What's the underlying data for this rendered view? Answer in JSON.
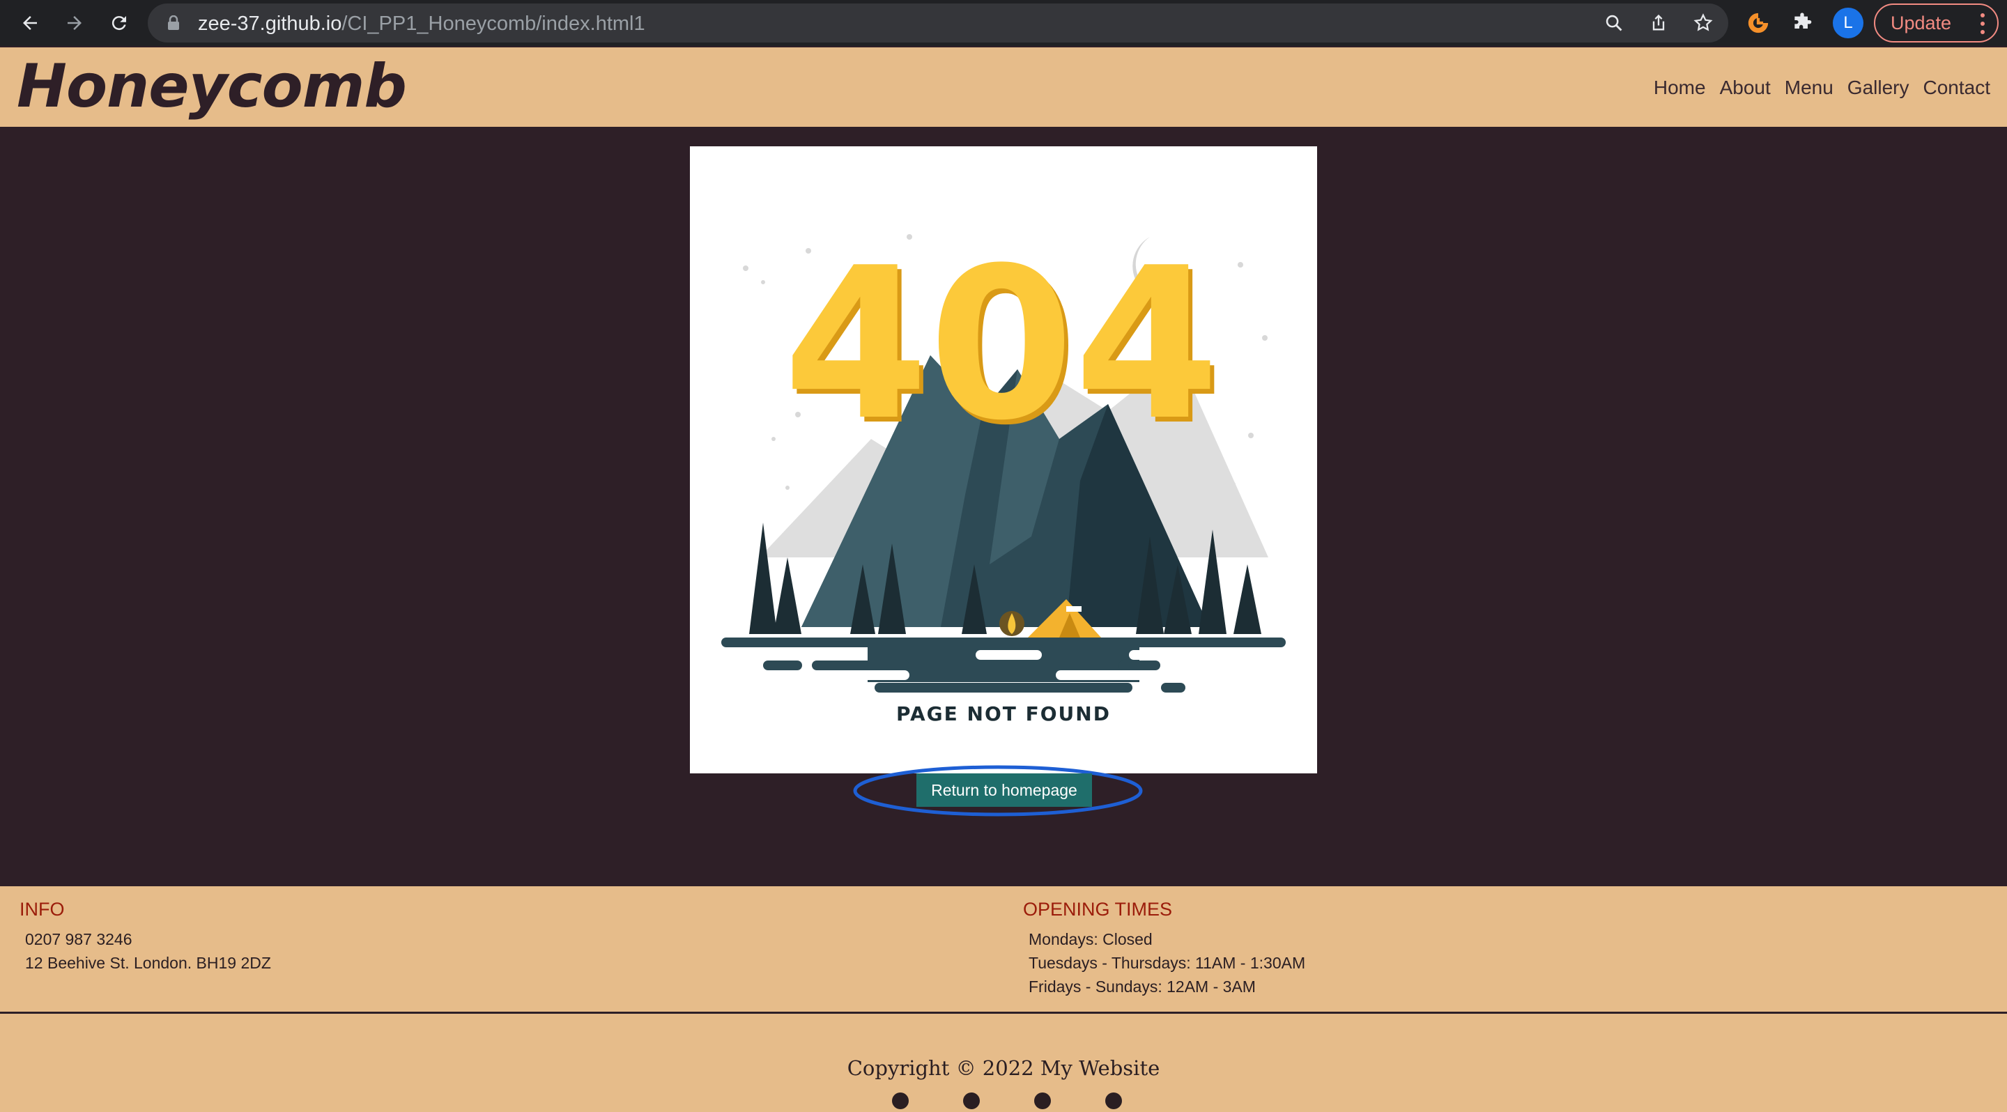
{
  "browser": {
    "url_host": "zee-37.github.io",
    "url_path": "/CI_PP1_Honeycomb/index.html1",
    "avatar_letter": "L",
    "update_label": "Update"
  },
  "site": {
    "brand": "Honeycomb",
    "nav": [
      "Home",
      "About",
      "Menu",
      "Gallery",
      "Contact"
    ]
  },
  "error_page": {
    "code": "404",
    "message": "PAGE NOT FOUND",
    "button_label": "Return to homepage",
    "highlight_color": "#1e5fd4"
  },
  "footer": {
    "info": {
      "heading": "INFO",
      "phone": "0207 987 3246",
      "address": "12 Beehive St. London. BH19 2DZ"
    },
    "opening_times": {
      "heading": "OPENING TIMES",
      "lines": [
        "Mondays: Closed",
        "Tuesdays - Thursdays: 11AM - 1:30AM",
        "Fridays - Sundays: 12AM - 3AM"
      ]
    },
    "copyright": "Copyright © 2022 My Website",
    "social_icons": [
      "facebook-icon",
      "twitter-icon",
      "instagram-icon",
      "pinterest-icon"
    ]
  },
  "colors": {
    "header_bg": "#e6bc8a",
    "page_bg": "#2e1f27",
    "button_bg": "#1f6e6b",
    "heading_red": "#9b1c0a"
  }
}
